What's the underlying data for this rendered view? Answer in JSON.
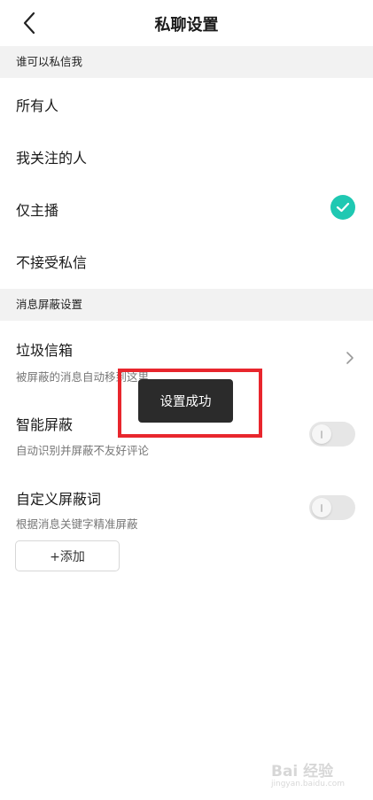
{
  "nav": {
    "title": "私聊设置"
  },
  "who_can_message": {
    "header": "谁可以私信我",
    "options": [
      {
        "label": "所有人",
        "selected": false
      },
      {
        "label": "我关注的人",
        "selected": false
      },
      {
        "label": "仅主播",
        "selected": true
      },
      {
        "label": "不接受私信",
        "selected": false
      }
    ]
  },
  "filter_settings": {
    "header": "消息屏蔽设置",
    "spam": {
      "title": "垃圾信箱",
      "subtitle": "被屏蔽的消息自动移到这里"
    },
    "smart": {
      "title": "智能屏蔽",
      "subtitle": "自动识别并屏蔽不友好评论",
      "enabled": false
    },
    "custom": {
      "title": "自定义屏蔽词",
      "subtitle": "根据消息关键字精准屏蔽",
      "enabled": false
    },
    "add_label": "+添加"
  },
  "toast": {
    "text": "设置成功"
  },
  "watermark": {
    "main": "Bai 经验",
    "sub": "jingyan.baidu.com"
  },
  "colors": {
    "accent": "#1fc8b2",
    "highlight": "#e8262d",
    "section_bg": "#f2f2f2"
  }
}
